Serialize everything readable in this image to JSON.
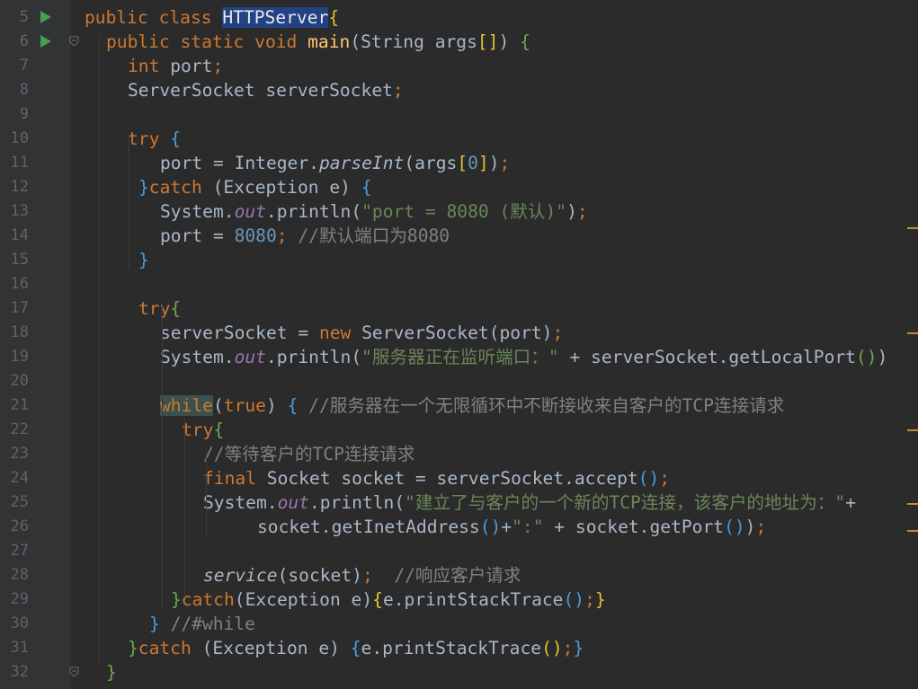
{
  "editor": {
    "lines": [
      {
        "num": "5",
        "run": true,
        "fold": false,
        "indent": 0,
        "tokens": [
          [
            "kw",
            "public class "
          ],
          [
            "cls-hl",
            "HTTPServer"
          ],
          [
            "br-y",
            "{"
          ]
        ]
      },
      {
        "num": "6",
        "run": true,
        "fold": true,
        "indent": 1,
        "tokens": [
          [
            "kw",
            "public static void "
          ],
          [
            "fn",
            "main"
          ],
          [
            "",
            "(String args"
          ],
          [
            "br-y",
            "[]"
          ],
          [
            "",
            ") "
          ],
          [
            "br-g",
            "{"
          ]
        ]
      },
      {
        "num": "7",
        "indent": 2,
        "tokens": [
          [
            "kw",
            "int "
          ],
          [
            "",
            "port"
          ],
          [
            "kw",
            ";"
          ]
        ]
      },
      {
        "num": "8",
        "indent": 2,
        "tokens": [
          [
            "",
            "ServerSocket serverSocket"
          ],
          [
            "kw",
            ";"
          ]
        ]
      },
      {
        "num": "9",
        "indent": 0,
        "tokens": []
      },
      {
        "num": "10",
        "indent": 2,
        "tokens": [
          [
            "kw",
            "try "
          ],
          [
            "br-b",
            "{"
          ]
        ]
      },
      {
        "num": "11",
        "indent": 3.5,
        "tokens": [
          [
            "",
            "port = Integer."
          ],
          [
            "it",
            "parseInt"
          ],
          [
            "",
            "(args"
          ],
          [
            "br-y",
            "["
          ],
          [
            "num",
            "0"
          ],
          [
            "br-y",
            "]"
          ],
          [
            "",
            ")"
          ],
          [
            "kw",
            ";"
          ]
        ]
      },
      {
        "num": "12",
        "indent": 2.5,
        "tokens": [
          [
            "br-b",
            "}"
          ],
          [
            "kw",
            "catch "
          ],
          [
            "",
            "(Exception e) "
          ],
          [
            "br-b",
            "{"
          ]
        ]
      },
      {
        "num": "13",
        "indent": 3.5,
        "tokens": [
          [
            "",
            "System."
          ],
          [
            "fld",
            "out"
          ],
          [
            "",
            ".println("
          ],
          [
            "st",
            "\"port = 8080 (默认)\""
          ],
          [
            "",
            ")"
          ],
          [
            "kw",
            ";"
          ]
        ]
      },
      {
        "num": "14",
        "indent": 3.5,
        "tokens": [
          [
            "",
            "port = "
          ],
          [
            "num",
            "8080"
          ],
          [
            "kw",
            "; "
          ],
          [
            "cm",
            "//默认端口为8080"
          ]
        ]
      },
      {
        "num": "15",
        "indent": 2.5,
        "tokens": [
          [
            "br-b",
            "}"
          ]
        ]
      },
      {
        "num": "16",
        "indent": 0,
        "tokens": []
      },
      {
        "num": "17",
        "indent": 2.5,
        "tokens": [
          [
            "kw",
            "try"
          ],
          [
            "br-g",
            "{"
          ]
        ]
      },
      {
        "num": "18",
        "indent": 3.5,
        "tokens": [
          [
            "",
            "serverSocket = "
          ],
          [
            "kw",
            "new "
          ],
          [
            "",
            "ServerSocket(port)"
          ],
          [
            "kw",
            ";"
          ]
        ]
      },
      {
        "num": "19",
        "indent": 3.5,
        "tokens": [
          [
            "",
            "System."
          ],
          [
            "fld",
            "out"
          ],
          [
            "",
            ".println("
          ],
          [
            "st",
            "\"服务器正在监听端口：\""
          ],
          [
            "",
            " + serverSocket.getLocalPort"
          ],
          [
            "br-g",
            "()"
          ],
          [
            "",
            ")"
          ]
        ]
      },
      {
        "num": "20",
        "indent": 0,
        "tokens": []
      },
      {
        "num": "21",
        "indent": 3.5,
        "tokens": [
          [
            "kw-hl kw",
            "while"
          ],
          [
            "",
            "("
          ],
          [
            "kw",
            "true"
          ],
          [
            "",
            ") "
          ],
          [
            "br-b",
            "{ "
          ],
          [
            "cm",
            "//服务器在一个无限循环中不断接收来自客户的TCP连接请求"
          ]
        ]
      },
      {
        "num": "22",
        "indent": 4.5,
        "tokens": [
          [
            "kw",
            "try"
          ],
          [
            "br-g",
            "{"
          ]
        ]
      },
      {
        "num": "23",
        "indent": 5.5,
        "tokens": [
          [
            "cm",
            "//等待客户的TCP连接请求"
          ]
        ]
      },
      {
        "num": "24",
        "indent": 5.5,
        "tokens": [
          [
            "kw",
            "final "
          ],
          [
            "",
            "Socket socket = serverSocket.accept"
          ],
          [
            "br-b",
            "()"
          ],
          [
            "kw",
            ";"
          ]
        ]
      },
      {
        "num": "25",
        "indent": 5.5,
        "tokens": [
          [
            "",
            "System."
          ],
          [
            "fld",
            "out"
          ],
          [
            "",
            ".println("
          ],
          [
            "st",
            "\"建立了与客户的一个新的TCP连接，该客户的地址为：\""
          ],
          [
            "",
            "+"
          ]
        ]
      },
      {
        "num": "26",
        "indent": 8,
        "tokens": [
          [
            "",
            "socket.getInetAddress"
          ],
          [
            "br-b",
            "()"
          ],
          [
            "",
            "+"
          ],
          [
            "st",
            "\":\""
          ],
          [
            "",
            " + socket.getPort"
          ],
          [
            "br-b",
            "()"
          ],
          [
            "",
            ")"
          ],
          [
            "kw",
            ";"
          ]
        ]
      },
      {
        "num": "27",
        "indent": 0,
        "tokens": []
      },
      {
        "num": "28",
        "indent": 5.5,
        "tokens": [
          [
            "it",
            "service"
          ],
          [
            "",
            "(socket)"
          ],
          [
            "kw",
            ";"
          ],
          [
            "",
            "  "
          ],
          [
            "cm",
            "//响应客户请求"
          ]
        ]
      },
      {
        "num": "29",
        "indent": 4.0,
        "tokens": [
          [
            "br-g",
            "}"
          ],
          [
            "kw",
            "catch"
          ],
          [
            "",
            "(Exception e)"
          ],
          [
            "br-y",
            "{"
          ],
          [
            "",
            "e.printStackTrace"
          ],
          [
            "br-b",
            "()"
          ],
          [
            "kw",
            ";"
          ],
          [
            "br-y",
            "}"
          ]
        ]
      },
      {
        "num": "30",
        "indent": 3.0,
        "tokens": [
          [
            "br-b",
            "} "
          ],
          [
            "cm",
            "//#while"
          ]
        ]
      },
      {
        "num": "31",
        "indent": 2.0,
        "tokens": [
          [
            "br-g",
            "}"
          ],
          [
            "kw",
            "catch "
          ],
          [
            "",
            "(Exception e) "
          ],
          [
            "br-b",
            "{"
          ],
          [
            "",
            "e.printStackTrace"
          ],
          [
            "br-y",
            "()"
          ],
          [
            "kw",
            ";"
          ],
          [
            "br-b",
            "}"
          ]
        ]
      },
      {
        "num": "32",
        "fold": true,
        "indent": 1.0,
        "tokens": [
          [
            "br-g",
            "}"
          ]
        ]
      }
    ],
    "error_stripe_marks": 6
  }
}
